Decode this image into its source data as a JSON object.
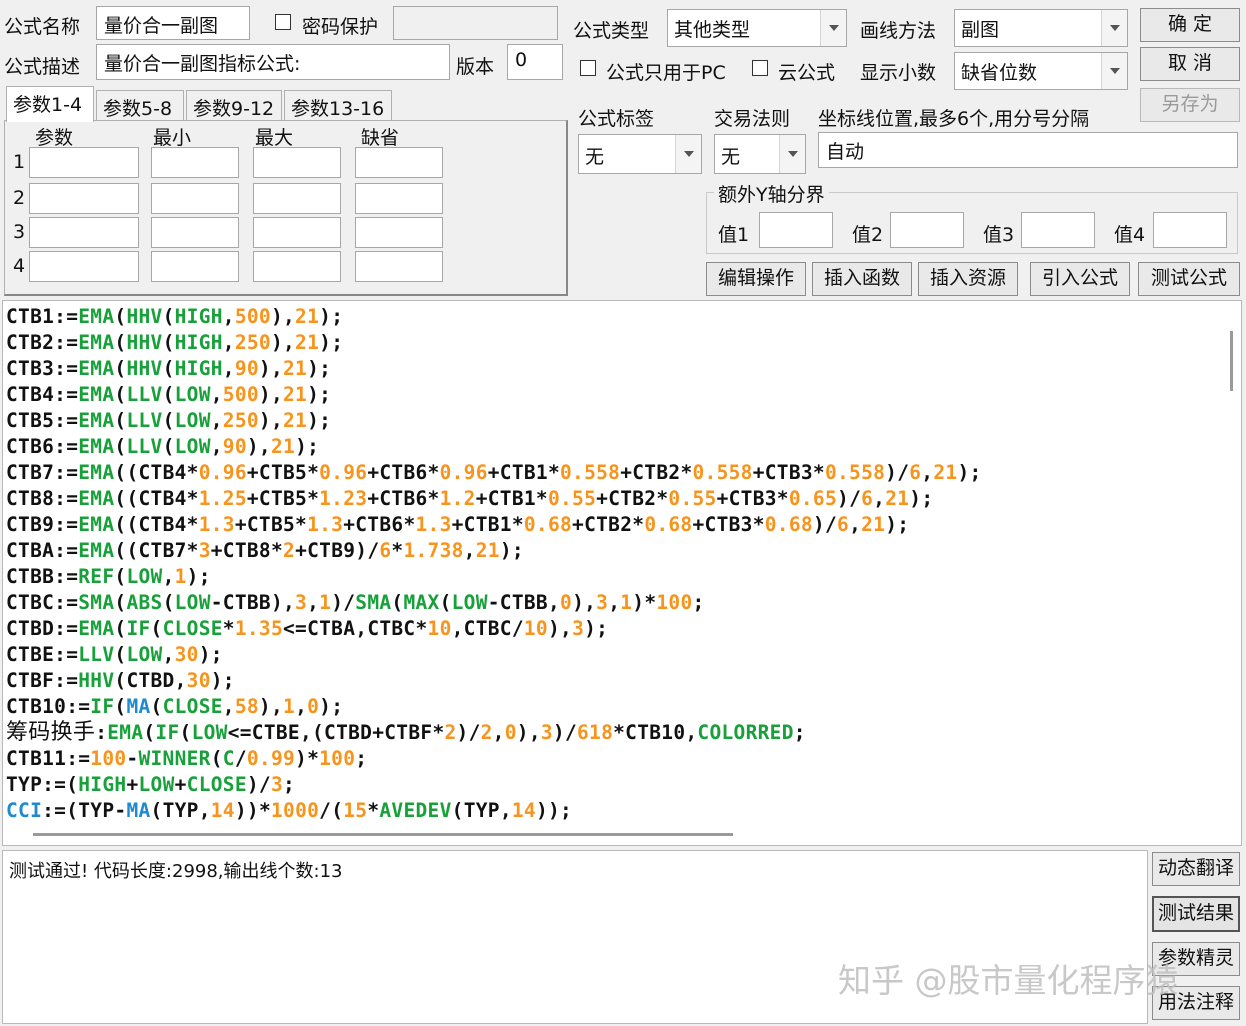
{
  "form": {
    "name_label": "公式名称",
    "name_value": "量价合一副图",
    "password_label": "密码保护",
    "password_value": "",
    "desc_label": "公式描述",
    "desc_value": "量价合一副图指标公式:",
    "version_label": "版本",
    "version_value": "0",
    "type_label": "公式类型",
    "type_value": "其他类型",
    "draw_label": "画线方法",
    "draw_value": "副图",
    "pc_only_label": "公式只用于PC",
    "cloud_label": "云公式",
    "decimals_label": "显示小数",
    "decimals_value": "缺省位数"
  },
  "buttons": {
    "ok": "确 定",
    "cancel": "取 消",
    "save_as": "另存为",
    "edit_op": "编辑操作",
    "insert_func": "插入函数",
    "insert_res": "插入资源",
    "import_formula": "引入公式",
    "test_formula": "测试公式",
    "dyn_translate": "动态翻译",
    "test_result": "测试结果",
    "param_wizard": "参数精灵",
    "usage_note": "用法注释"
  },
  "tabs": [
    "参数1-4",
    "参数5-8",
    "参数9-12",
    "参数13-16"
  ],
  "params": {
    "headers": [
      "参数",
      "最小",
      "最大",
      "缺省"
    ],
    "rows": [
      "1",
      "2",
      "3",
      "4"
    ]
  },
  "tag": {
    "label": "公式标签",
    "value": "无",
    "trade_label": "交易法则",
    "trade_value": "无",
    "coord_label": "坐标线位置,最多6个,用分号分隔",
    "coord_value": "自动"
  },
  "yaxis": {
    "title": "额外Y轴分界",
    "labels": [
      "值1",
      "值2",
      "值3",
      "值4"
    ]
  },
  "code": [
    "CTB1:=EMA(HHV(HIGH,500),21);",
    "CTB2:=EMA(HHV(HIGH,250),21);",
    "CTB3:=EMA(HHV(HIGH,90),21);",
    "CTB4:=EMA(LLV(LOW,500),21);",
    "CTB5:=EMA(LLV(LOW,250),21);",
    "CTB6:=EMA(LLV(LOW,90),21);",
    "CTB7:=EMA((CTB4*0.96+CTB5*0.96+CTB6*0.96+CTB1*0.558+CTB2*0.558+CTB3*0.558)/6,21);",
    "CTB8:=EMA((CTB4*1.25+CTB5*1.23+CTB6*1.2+CTB1*0.55+CTB2*0.55+CTB3*0.65)/6,21);",
    "CTB9:=EMA((CTB4*1.3+CTB5*1.3+CTB6*1.3+CTB1*0.68+CTB2*0.68+CTB3*0.68)/6,21);",
    "CTBA:=EMA((CTB7*3+CTB8*2+CTB9)/6*1.738,21);",
    "CTBB:=REF(LOW,1);",
    "CTBC:=SMA(ABS(LOW-CTBB),3,1)/SMA(MAX(LOW-CTBB,0),3,1)*100;",
    "CTBD:=EMA(IF(CLOSE*1.35<=CTBA,CTBC*10,CTBC/10),3);",
    "CTBE:=LLV(LOW,30);",
    "CTBF:=HHV(CTBD,30);",
    "CTB10:=IF(MA(CLOSE,58),1,0);",
    "筹码换手:EMA(IF(LOW<=CTBE,(CTBD+CTBF*2)/2,0),3)/618*CTB10,COLORRED;",
    "CTB11:=100-WINNER(C/0.99)*100;",
    "TYP:=(HIGH+LOW+CLOSE)/3;",
    "CCI:=(TYP-MA(TYP,14))*1000/(15*AVEDEV(TYP,14));"
  ],
  "output_text": "测试通过! 代码长度:2998,输出线个数:13",
  "watermark": "知乎 @股市量化程序猿",
  "colors": {
    "function": "#18a03a",
    "number": "#f7941d",
    "blue": "#1e8bd0",
    "text": "#111111"
  }
}
